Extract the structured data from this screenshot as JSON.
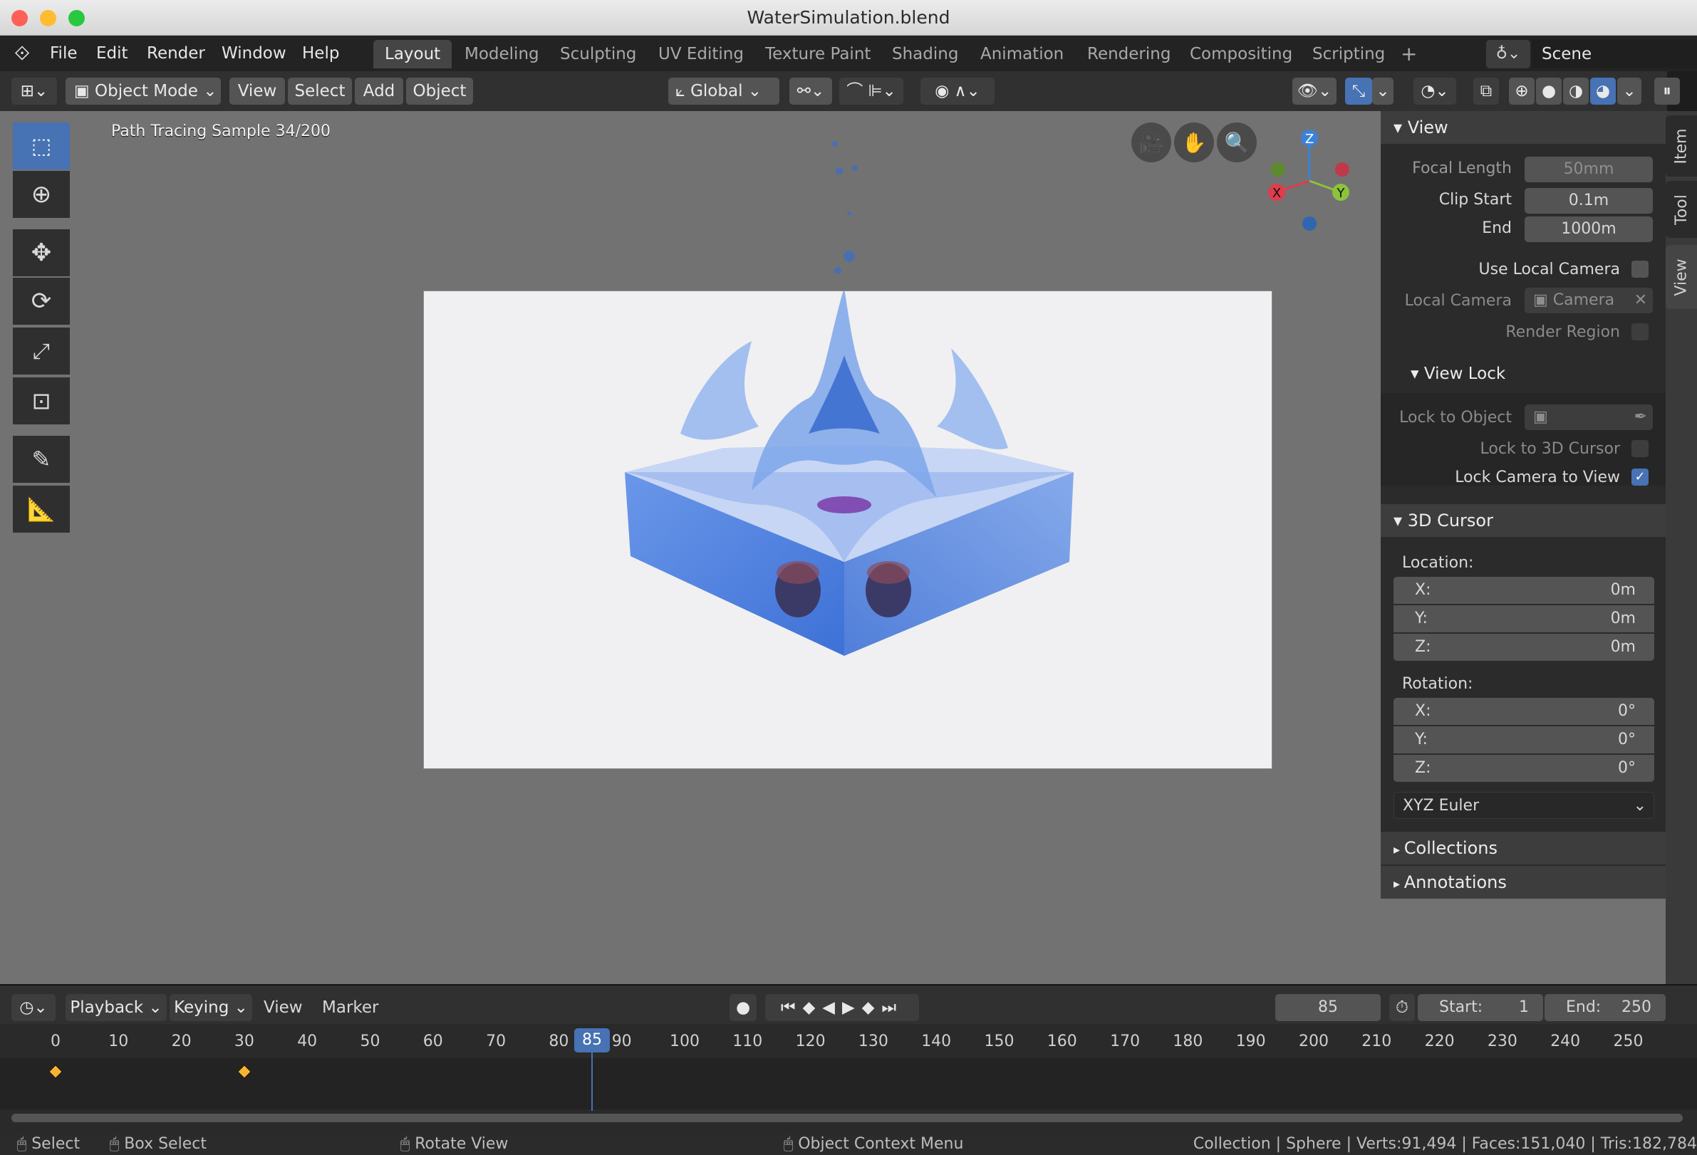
{
  "window": {
    "title": "WaterSimulation.blend"
  },
  "menus": [
    "File",
    "Edit",
    "Render",
    "Window",
    "Help"
  ],
  "workspaces": [
    "Layout",
    "Modeling",
    "Sculpting",
    "UV Editing",
    "Texture Paint",
    "Shading",
    "Animation",
    "Rendering",
    "Compositing",
    "Scripting"
  ],
  "scene": "Scene",
  "header": {
    "mode": "Object Mode",
    "view": "View",
    "select": "Select",
    "add": "Add",
    "object": "Object",
    "orientation": "Global"
  },
  "viewport": {
    "overlay_text": "Path Tracing Sample 34/200"
  },
  "gizmo": {
    "x": "X",
    "y": "Y",
    "z": "Z"
  },
  "npanel": {
    "tabs": [
      "Item",
      "Tool",
      "View"
    ],
    "view": {
      "title": "View",
      "focal_length_label": "Focal Length",
      "focal_length": "50mm",
      "clip_start_label": "Clip Start",
      "clip_start": "0.1m",
      "end_label": "End",
      "end": "1000m",
      "use_local_camera": "Use Local Camera",
      "local_camera_label": "Local Camera",
      "local_camera": "Camera",
      "render_region": "Render Region"
    },
    "view_lock": {
      "title": "View Lock",
      "lock_to_object": "Lock to Object",
      "lock_to_cursor": "Lock to 3D Cursor",
      "lock_camera": "Lock Camera to View"
    },
    "cursor": {
      "title": "3D Cursor",
      "location_label": "Location:",
      "loc": [
        {
          "axis": "X:",
          "value": "0m"
        },
        {
          "axis": "Y:",
          "value": "0m"
        },
        {
          "axis": "Z:",
          "value": "0m"
        }
      ],
      "rotation_label": "Rotation:",
      "rot": [
        {
          "axis": "X:",
          "value": "0°"
        },
        {
          "axis": "Y:",
          "value": "0°"
        },
        {
          "axis": "Z:",
          "value": "0°"
        }
      ],
      "rotation_mode": "XYZ Euler"
    },
    "collections": "Collections",
    "annotations": "Annotations"
  },
  "timeline": {
    "playback": "Playback",
    "keying": "Keying",
    "view": "View",
    "marker": "Marker",
    "current_frame": "85",
    "start_label": "Start:",
    "start": "1",
    "end_label": "End:",
    "end": "250",
    "ticks": [
      "0",
      "10",
      "20",
      "30",
      "40",
      "50",
      "60",
      "70",
      "80",
      "90",
      "100",
      "110",
      "120",
      "130",
      "140",
      "150",
      "160",
      "170",
      "180",
      "190",
      "200",
      "210",
      "220",
      "230",
      "240",
      "250"
    ],
    "keyframes": [
      0,
      30
    ]
  },
  "status": {
    "select": "Select",
    "box_select": "Box Select",
    "rotate": "Rotate View",
    "context": "Object Context Menu",
    "stats": "Collection | Sphere | Verts:91,494 | Faces:151,040 | Tris:182,784"
  }
}
